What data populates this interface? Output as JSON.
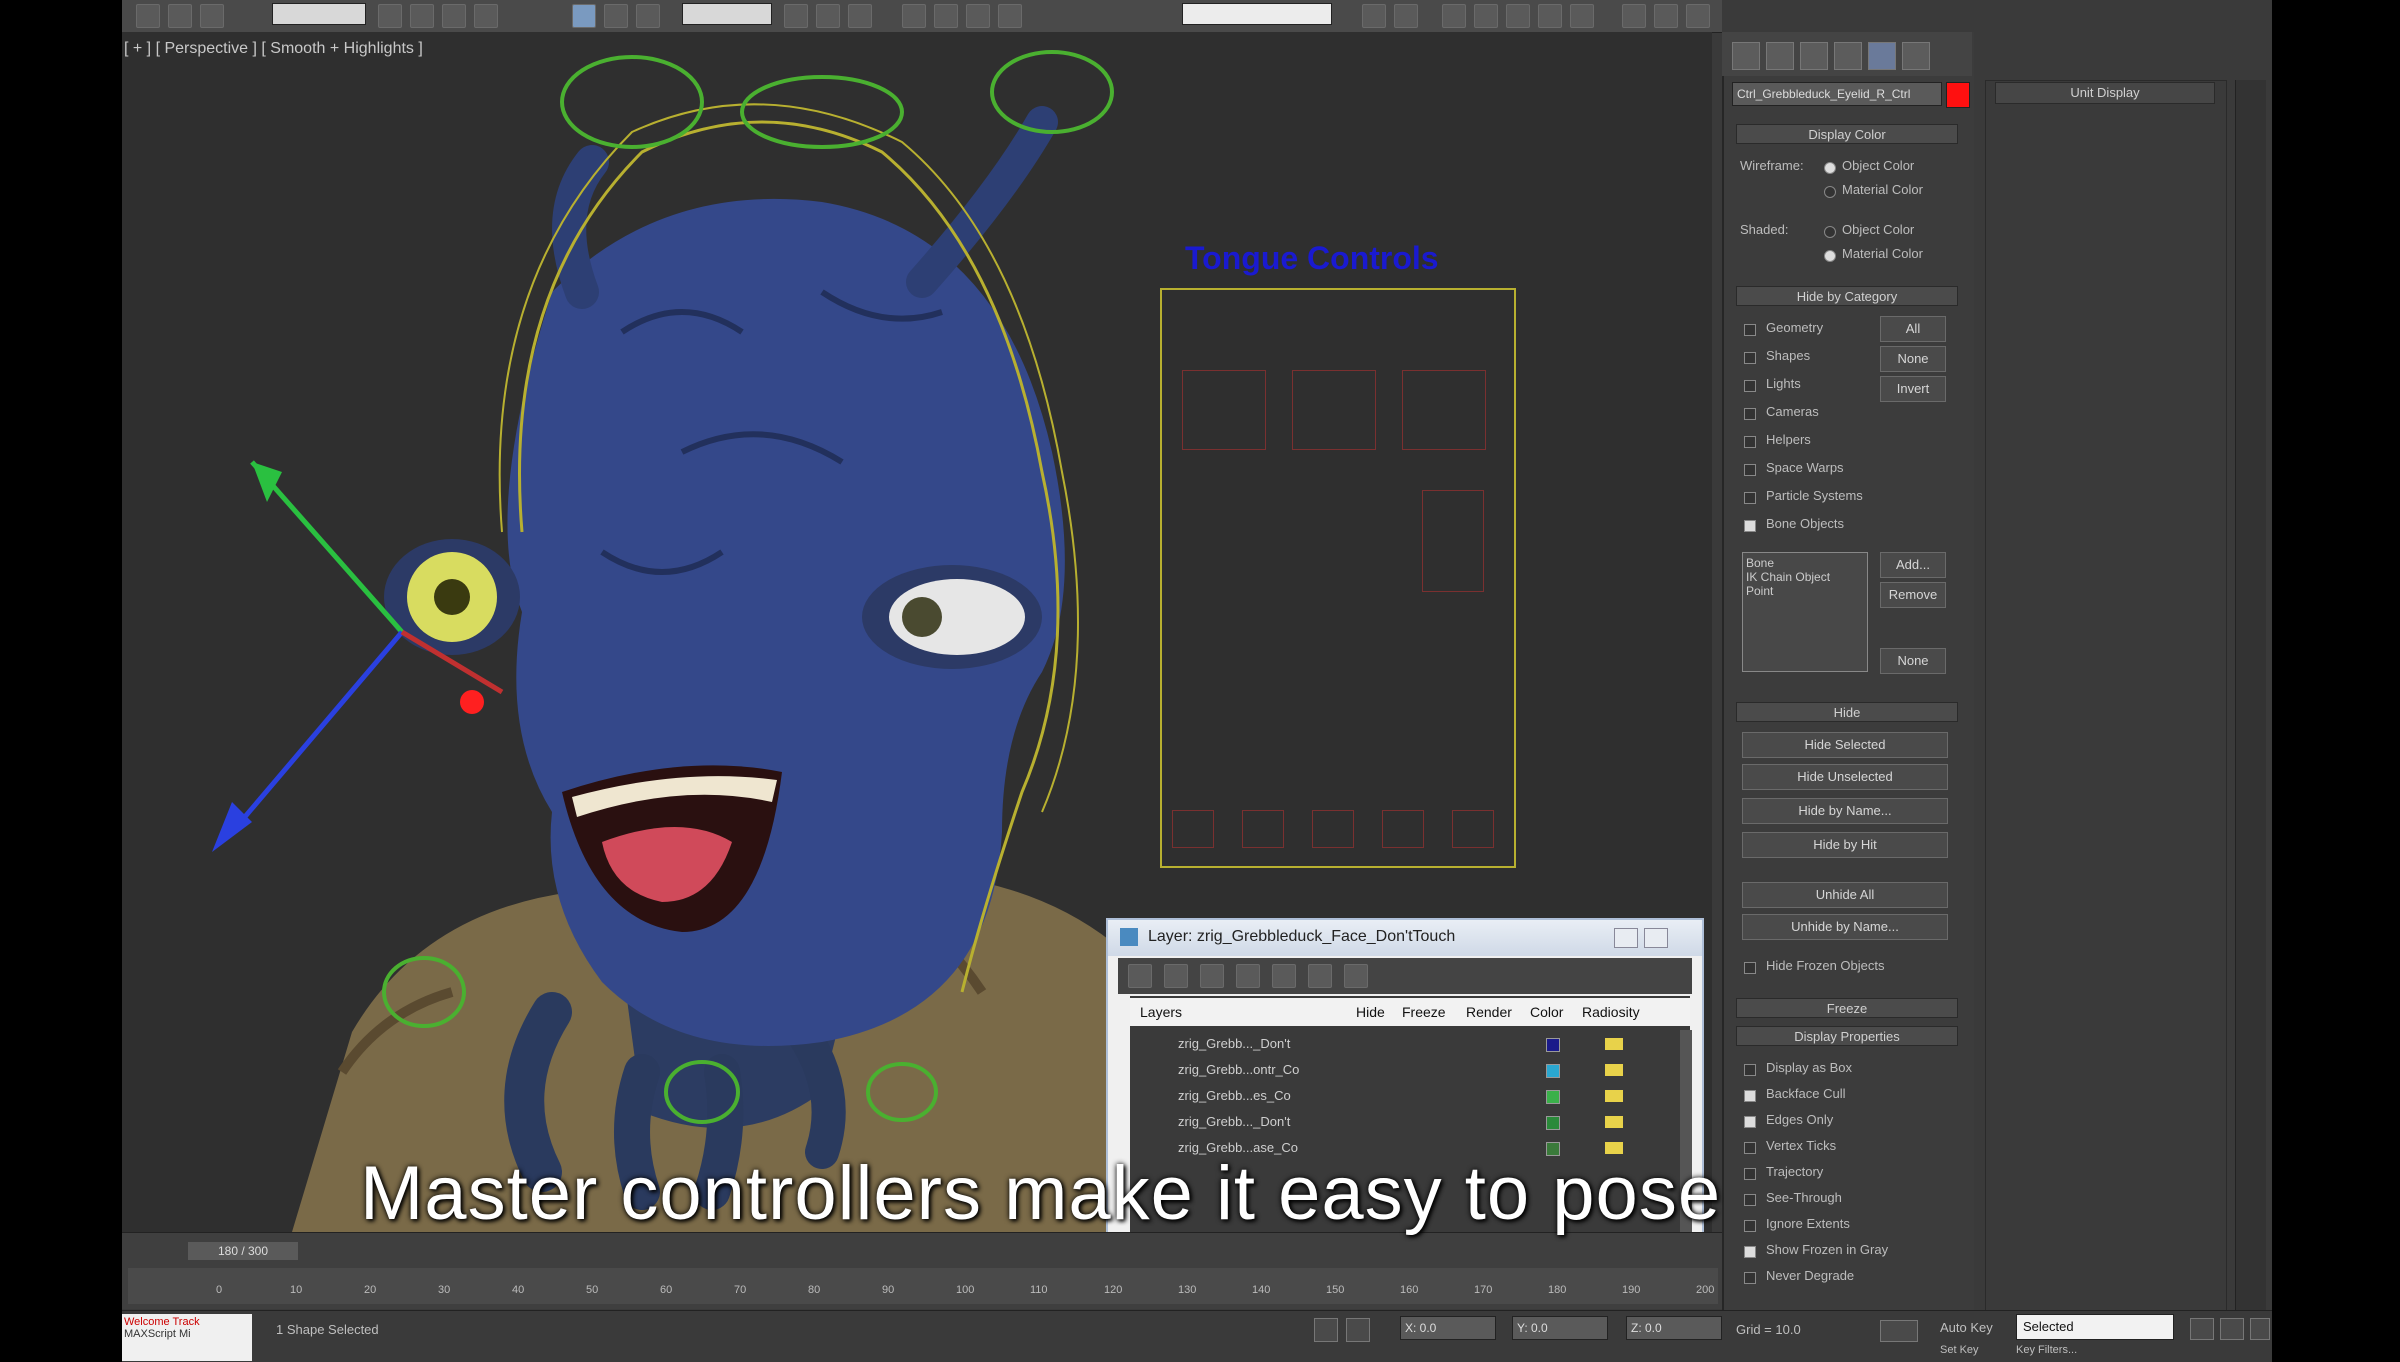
{
  "viewport": {
    "label": "[ + ] [ Perspective ] [ Smooth + Highlights ]"
  },
  "tongue_panel": {
    "title": "Tongue Controls"
  },
  "toolbar": {
    "field_1": "",
    "field_2": ""
  },
  "command_panel": {
    "object_name": "Ctrl_Grebbleduck_Eyelid_R_Ctrl",
    "color_hex": "#ff1010",
    "display_color": {
      "title": "Display Color",
      "wireframe_label": "Wireframe:",
      "shaded_label": "Shaded:",
      "opt_object_color": "Object Color",
      "opt_material_color": "Material Color"
    },
    "hide_by_category": {
      "title": "Hide by Category",
      "items": [
        "Geometry",
        "Shapes",
        "Lights",
        "Cameras",
        "Helpers",
        "Space Warps",
        "Particle Systems",
        "Bone Objects"
      ],
      "btn_all": "All",
      "btn_none": "None",
      "btn_invert": "Invert",
      "list_items": [
        "Bone",
        "IK Chain Object",
        "Point"
      ],
      "btn_add": "Add...",
      "btn_remove": "Remove",
      "btn_none2": "None"
    },
    "hide": {
      "title": "Hide",
      "buttons": [
        "Hide Selected",
        "Hide Unselected",
        "Hide by Name...",
        "Hide by Hit",
        "Unhide All",
        "Unhide by Name..."
      ],
      "hide_frozen": "Hide Frozen Objects"
    },
    "freeze": {
      "title": "Freeze"
    },
    "display_properties": {
      "title": "Display Properties",
      "items": [
        "Display as Box",
        "Backface Cull",
        "Edges Only",
        "Vertex Ticks",
        "Trajectory",
        "See-Through",
        "Ignore Extents",
        "Show Frozen in Gray",
        "Never Degrade"
      ]
    }
  },
  "right_panel": {
    "title": "Unit Display"
  },
  "layer_dialog": {
    "title": "Layer: zrig_Grebbleduck_Face_Don'tTouch",
    "columns": [
      "Layers",
      "Hide",
      "Freeze",
      "Render",
      "Color",
      "Radiosity"
    ],
    "rows": [
      {
        "name": "zrig_Grebb..._Don't",
        "color": "#1a1a8a"
      },
      {
        "name": "zrig_Grebb...ontr_Co",
        "color": "#2aa7d0"
      },
      {
        "name": "zrig_Grebb...es_Co",
        "color": "#3ab04a"
      },
      {
        "name": "zrig_Grebb..._Don't",
        "color": "#2a8a3a"
      },
      {
        "name": "zrig_Grebb...ase_Co",
        "color": "#3a7a3a"
      }
    ]
  },
  "timeline": {
    "frame_counter": "180 / 300",
    "ticks": [
      "0",
      "10",
      "20",
      "30",
      "40",
      "50",
      "60",
      "70",
      "80",
      "90",
      "100",
      "110",
      "120",
      "130",
      "140",
      "150",
      "160",
      "170",
      "180",
      "190",
      "200"
    ]
  },
  "status_bar": {
    "mini_list_1": "Welcome  Track",
    "mini_list_2": "MAXScript Mi",
    "selection": "1 Shape Selected",
    "x_value": "X: 0.0",
    "y_value": "Y: 0.0",
    "z_value": "Z: 0.0",
    "grid": "Grid = 10.0",
    "auto_key": "Auto Key",
    "set_key": "Set Key",
    "selected_dropdown": "Selected",
    "key_filters": "Key Filters..."
  },
  "subtitle": "Master controllers make it easy to pose"
}
